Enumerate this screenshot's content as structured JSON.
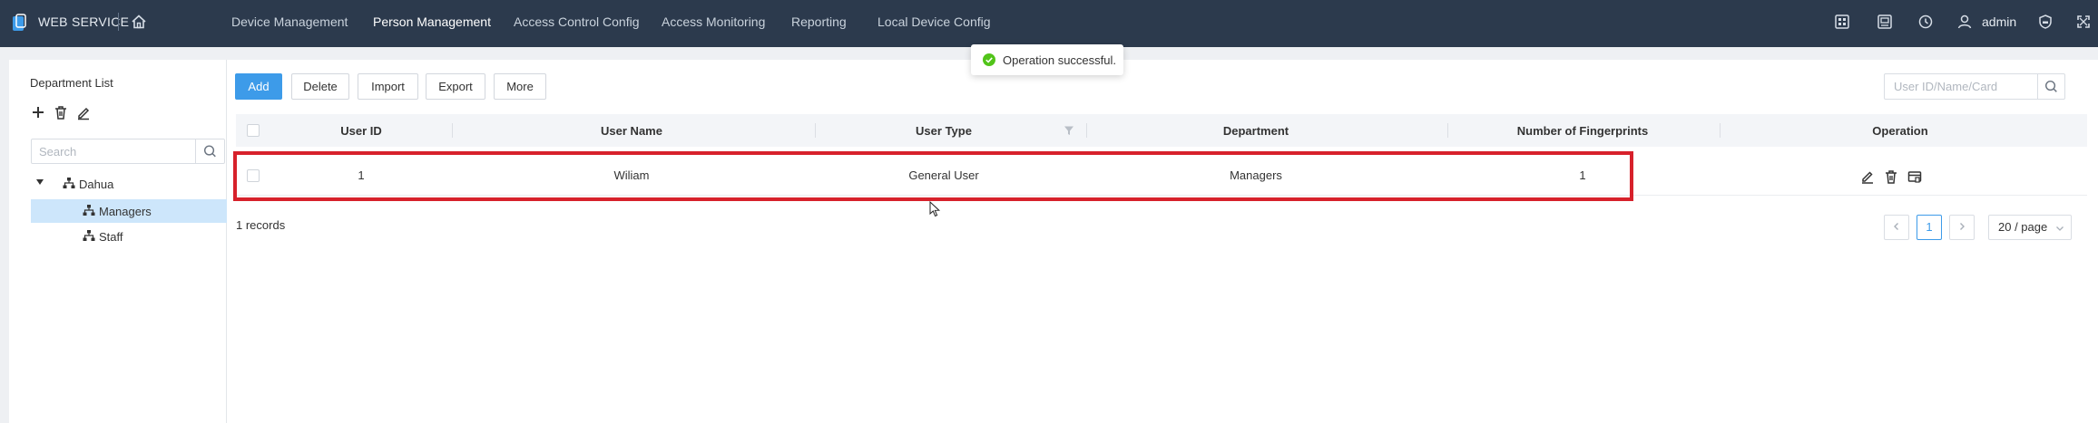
{
  "app": {
    "brand": "WEB SERVICE",
    "user": "admin",
    "accent": "#3d9be9",
    "header_bg": "#2c3a4d"
  },
  "nav": {
    "items": [
      {
        "label": "Device Management"
      },
      {
        "label": "Person Management",
        "active": true
      },
      {
        "label": "Access Control Config"
      },
      {
        "label": "Access Monitoring"
      },
      {
        "label": "Reporting"
      },
      {
        "label": "Local Device Config"
      }
    ]
  },
  "toast": {
    "text": "Operation successful."
  },
  "sidebar": {
    "title": "Department List",
    "search_placeholder": "Search",
    "tree": [
      {
        "label": "Dahua",
        "expanded": true,
        "level": 0
      },
      {
        "label": "Managers",
        "selected": true,
        "level": 1
      },
      {
        "label": "Staff",
        "level": 1
      }
    ]
  },
  "toolbar": {
    "add": "Add",
    "delete": "Delete",
    "import": "Import",
    "export": "Export",
    "more": "More",
    "search_placeholder": "User ID/Name/Card"
  },
  "table": {
    "columns": [
      "User ID",
      "User Name",
      "User Type",
      "Department",
      "Number of Fingerprints",
      "Operation"
    ],
    "rows": [
      {
        "user_id": "1",
        "user_name": "Wiliam",
        "user_type": "General User",
        "department": "Managers",
        "fingerprints": "1"
      }
    ]
  },
  "footer": {
    "records": "1 records",
    "current_page": "1",
    "page_size": "20 / page"
  }
}
